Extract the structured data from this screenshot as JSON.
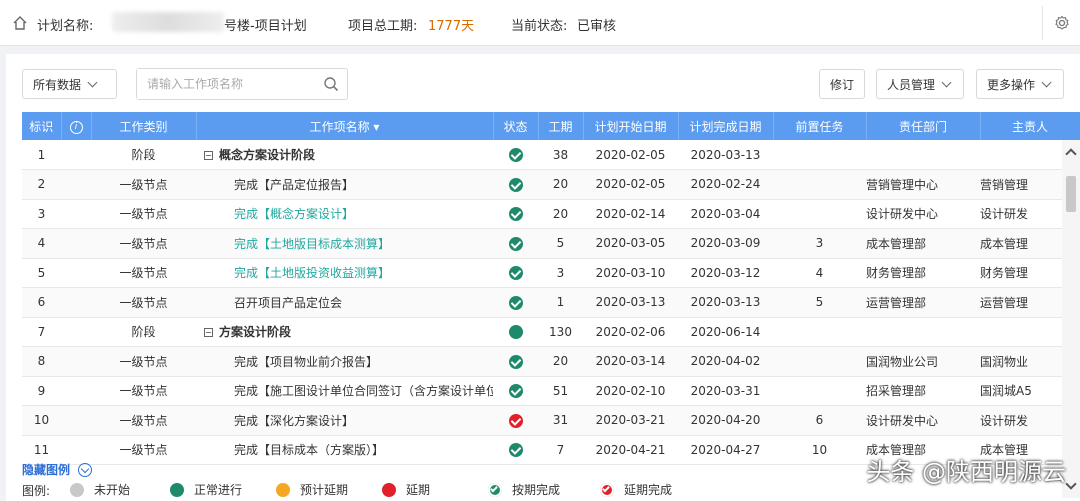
{
  "header": {
    "plan_label": "计划名称:",
    "plan_suffix": "号楼-项目计划",
    "duration_label": "项目总工期:",
    "duration_value": "1777天",
    "status_label": "当前状态:",
    "status_value": "已审核"
  },
  "toolbar": {
    "filter_label": "所有数据",
    "search_placeholder": "请输入工作项名称",
    "revise_label": "修订",
    "people_label": "人员管理",
    "more_label": "更多操作"
  },
  "table": {
    "columns": [
      "标识",
      "",
      "工作类别",
      "工作项名称 ▾",
      "状态",
      "工期",
      "计划开始日期",
      "计划完成日期",
      "前置任务",
      "责任部门",
      "主责人"
    ],
    "rows": [
      {
        "id": "1",
        "category": "阶段",
        "name": "概念方案设计阶段",
        "phase": true,
        "status": "check",
        "duration": "38",
        "start": "2020-02-05",
        "end": "2020-03-13",
        "pre": "",
        "dept": "",
        "owner": ""
      },
      {
        "id": "2",
        "category": "一级节点",
        "name": "完成【产品定位报告】",
        "phase": false,
        "link": false,
        "status": "check",
        "duration": "20",
        "start": "2020-02-05",
        "end": "2020-02-24",
        "pre": "",
        "dept": "营销管理中心",
        "owner": "营销管理"
      },
      {
        "id": "3",
        "category": "一级节点",
        "name": "完成【概念方案设计】",
        "phase": false,
        "link": true,
        "status": "check",
        "duration": "20",
        "start": "2020-02-14",
        "end": "2020-03-04",
        "pre": "",
        "dept": "设计研发中心",
        "owner": "设计研发"
      },
      {
        "id": "4",
        "category": "一级节点",
        "name": "完成【土地版目标成本测算】",
        "phase": false,
        "link": true,
        "status": "check",
        "duration": "5",
        "start": "2020-03-05",
        "end": "2020-03-09",
        "pre": "3",
        "dept": "成本管理部",
        "owner": "成本管理"
      },
      {
        "id": "5",
        "category": "一级节点",
        "name": "完成【土地版投资收益测算】",
        "phase": false,
        "link": true,
        "status": "check",
        "duration": "3",
        "start": "2020-03-10",
        "end": "2020-03-12",
        "pre": "4",
        "dept": "财务管理部",
        "owner": "财务管理"
      },
      {
        "id": "6",
        "category": "一级节点",
        "name": "召开项目产品定位会",
        "phase": false,
        "link": false,
        "status": "check",
        "duration": "1",
        "start": "2020-03-13",
        "end": "2020-03-13",
        "pre": "5",
        "dept": "运营管理部",
        "owner": "运营管理"
      },
      {
        "id": "7",
        "category": "阶段",
        "name": "方案设计阶段",
        "phase": true,
        "status": "normal",
        "duration": "130",
        "start": "2020-02-06",
        "end": "2020-06-14",
        "pre": "",
        "dept": "",
        "owner": ""
      },
      {
        "id": "8",
        "category": "一级节点",
        "name": "完成【项目物业前介报告】",
        "phase": false,
        "link": false,
        "status": "check",
        "duration": "20",
        "start": "2020-03-14",
        "end": "2020-04-02",
        "pre": "",
        "dept": "国润物业公司",
        "owner": "国润物业"
      },
      {
        "id": "9",
        "category": "一级节点",
        "name": "完成【施工图设计单位合同签订（含方案设计单位",
        "phase": false,
        "link": false,
        "status": "check",
        "duration": "51",
        "start": "2020-02-10",
        "end": "2020-03-31",
        "pre": "",
        "dept": "招采管理部",
        "owner": "国润城A5"
      },
      {
        "id": "10",
        "category": "一级节点",
        "name": "完成【深化方案设计】",
        "phase": false,
        "link": false,
        "status": "late",
        "duration": "31",
        "start": "2020-03-21",
        "end": "2020-04-20",
        "pre": "6",
        "dept": "设计研发中心",
        "owner": "设计研发"
      },
      {
        "id": "11",
        "category": "一级节点",
        "name": "完成【目标成本（方案版）】",
        "phase": false,
        "link": false,
        "status": "check",
        "duration": "7",
        "start": "2020-04-21",
        "end": "2020-04-27",
        "pre": "10",
        "dept": "成本管理部",
        "owner": "成本管理"
      }
    ]
  },
  "legend": {
    "toggle_label": "隐藏图例",
    "label": "图例:",
    "items": [
      {
        "label": "未开始",
        "color": "#c8c8c8",
        "kind": "dot"
      },
      {
        "label": "正常进行",
        "color": "#1f8a6b",
        "kind": "dot"
      },
      {
        "label": "预计延期",
        "color": "#f5a623",
        "kind": "dot"
      },
      {
        "label": "延期",
        "color": "#e0202a",
        "kind": "dot"
      },
      {
        "label": "按期完成",
        "color": "#1f8a6b",
        "kind": "check"
      },
      {
        "label": "延期完成",
        "color": "#e0202a",
        "kind": "check"
      }
    ]
  },
  "watermark": "头条 @陕西明源云"
}
